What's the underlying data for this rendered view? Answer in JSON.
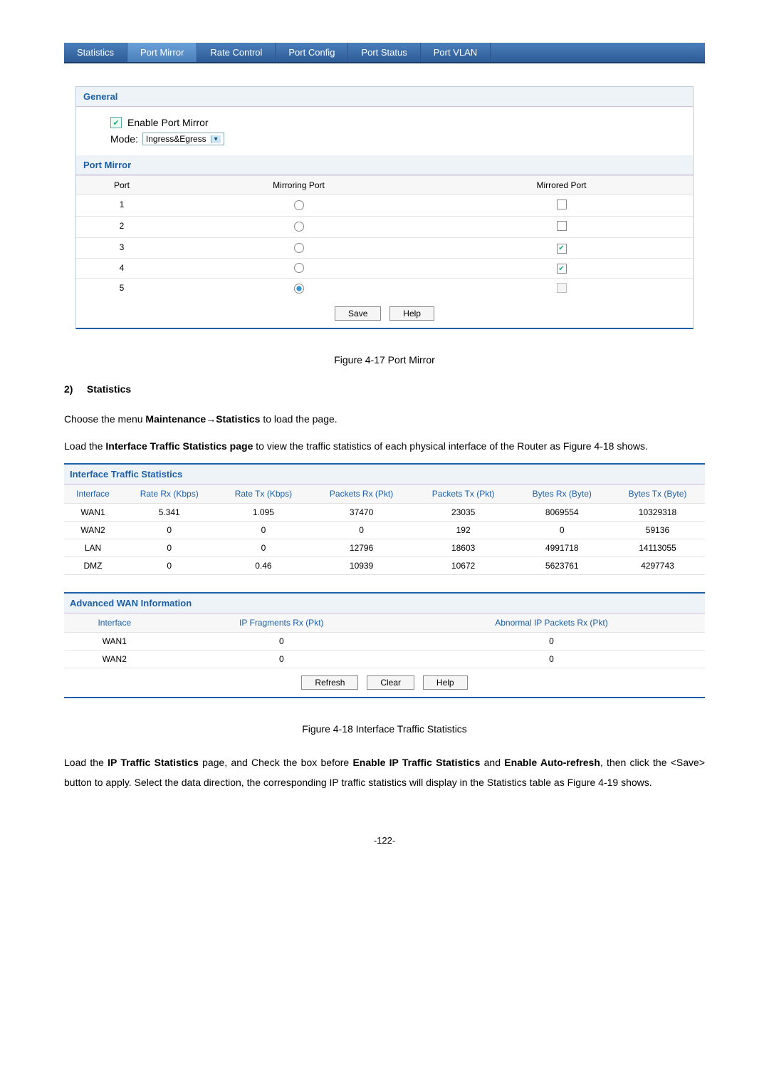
{
  "tabs": [
    "Statistics",
    "Port Mirror",
    "Rate Control",
    "Port Config",
    "Port Status",
    "Port VLAN"
  ],
  "general": {
    "title": "General",
    "enable_label": "Enable Port Mirror",
    "enable_checked": true,
    "mode_label": "Mode:",
    "mode_value": "Ingress&Egress"
  },
  "port_mirror": {
    "title": "Port Mirror",
    "cols": {
      "port": "Port",
      "mirroring": "Mirroring Port",
      "mirrored": "Mirrored Port"
    },
    "rows": [
      {
        "port": "1",
        "mirroring_selected": false,
        "mirrored_checked": false,
        "mirrored_disabled": false
      },
      {
        "port": "2",
        "mirroring_selected": false,
        "mirrored_checked": false,
        "mirrored_disabled": false
      },
      {
        "port": "3",
        "mirroring_selected": false,
        "mirrored_checked": true,
        "mirrored_disabled": false
      },
      {
        "port": "4",
        "mirroring_selected": false,
        "mirrored_checked": true,
        "mirrored_disabled": false
      },
      {
        "port": "5",
        "mirroring_selected": true,
        "mirrored_checked": false,
        "mirrored_disabled": true
      }
    ],
    "save": "Save",
    "help": "Help"
  },
  "fig1": "Figure 4-17 Port Mirror",
  "section2": {
    "heading_num": "2)",
    "heading": "Statistics",
    "p1a": "Choose the menu ",
    "p1b": "Maintenance→Statistics",
    "p1c": " to load the page.",
    "p2a": "Load the ",
    "p2b": "Interface Traffic Statistics page",
    "p2c": " to view the traffic statistics of each physical interface of the Router as Figure 4-18 shows."
  },
  "its": {
    "title": "Interface Traffic Statistics",
    "headers": [
      "Interface",
      "Rate Rx (Kbps)",
      "Rate Tx (Kbps)",
      "Packets Rx (Pkt)",
      "Packets Tx (Pkt)",
      "Bytes Rx (Byte)",
      "Bytes Tx (Byte)"
    ],
    "rows": [
      [
        "WAN1",
        "5.341",
        "1.095",
        "37470",
        "23035",
        "8069554",
        "10329318"
      ],
      [
        "WAN2",
        "0",
        "0",
        "0",
        "192",
        "0",
        "59136"
      ],
      [
        "LAN",
        "0",
        "0",
        "12796",
        "18603",
        "4991718",
        "14113055"
      ],
      [
        "DMZ",
        "0",
        "0.46",
        "10939",
        "10672",
        "5623761",
        "4297743"
      ]
    ]
  },
  "adv": {
    "title": "Advanced WAN Information",
    "headers": [
      "Interface",
      "IP Fragments Rx (Pkt)",
      "Abnormal IP Packets Rx (Pkt)"
    ],
    "rows": [
      [
        "WAN1",
        "0",
        "0"
      ],
      [
        "WAN2",
        "0",
        "0"
      ]
    ],
    "refresh": "Refresh",
    "clear": "Clear",
    "help": "Help"
  },
  "fig2": "Figure 4-18 Interface Traffic Statistics",
  "p3": {
    "a": "Load the ",
    "b": "IP Traffic Statistics",
    "c": " page, and Check the box before ",
    "d": "Enable IP Traffic Statistics",
    "e": " and ",
    "f": "Enable Auto-refresh",
    "g": ", then click the <Save> button to apply. Select the data direction, the corresponding IP traffic statistics will display in the Statistics table as Figure 4-19 shows."
  },
  "pagenum": "-122-"
}
